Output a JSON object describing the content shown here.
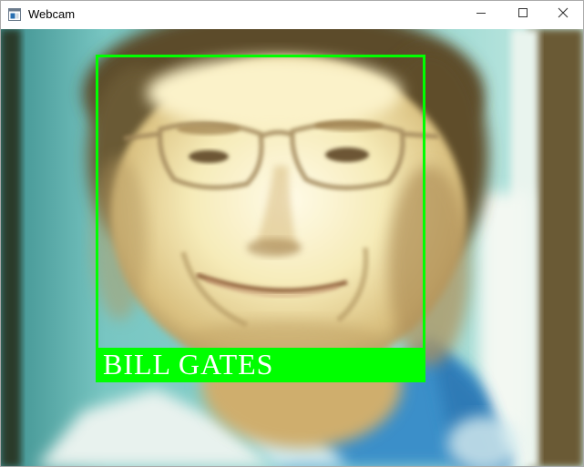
{
  "window": {
    "title": "Webcam",
    "icons": {
      "app": "app-window-icon",
      "minimize": "minimize-icon",
      "maximize": "maximize-icon",
      "close": "close-icon"
    }
  },
  "detection": {
    "label": "BILL GATES",
    "box_color": "#00ff00",
    "label_color": "#ffffff"
  }
}
